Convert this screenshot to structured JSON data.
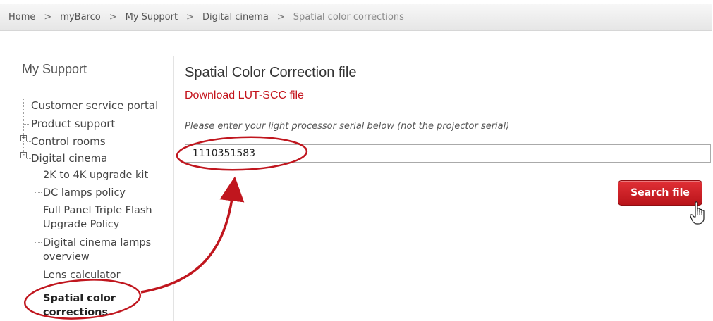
{
  "breadcrumb": {
    "items": [
      "Home",
      "myBarco",
      "My Support",
      "Digital cinema",
      "Spatial color corrections"
    ],
    "separator": ">"
  },
  "sidebar": {
    "title": "My Support",
    "items": [
      {
        "label": "Customer service portal"
      },
      {
        "label": "Product support"
      },
      {
        "label": "Control rooms",
        "expander": "+"
      },
      {
        "label": "Digital cinema",
        "expander": "-"
      }
    ],
    "children": [
      {
        "lines": [
          "2K to 4K upgrade kit"
        ]
      },
      {
        "lines": [
          "DC lamps policy"
        ]
      },
      {
        "lines": [
          "Full Panel Triple Flash",
          "Upgrade Policy"
        ]
      },
      {
        "lines": [
          "Digital cinema lamps",
          "overview"
        ]
      },
      {
        "lines": [
          "Lens calculator"
        ]
      },
      {
        "lines": [
          "Spatial color",
          "corrections"
        ],
        "active": true
      }
    ]
  },
  "main": {
    "title": "Spatial Color Correction file",
    "download_link": "Download LUT-SCC file",
    "hint": "Please enter your light processor serial below (not the projector serial)",
    "serial_value": "1110351583",
    "search_button": "Search file"
  },
  "colors": {
    "accent_red": "#c4121b",
    "annotation_red": "#c0161e"
  },
  "icons": {
    "cursor": "hand-pointer-icon"
  }
}
